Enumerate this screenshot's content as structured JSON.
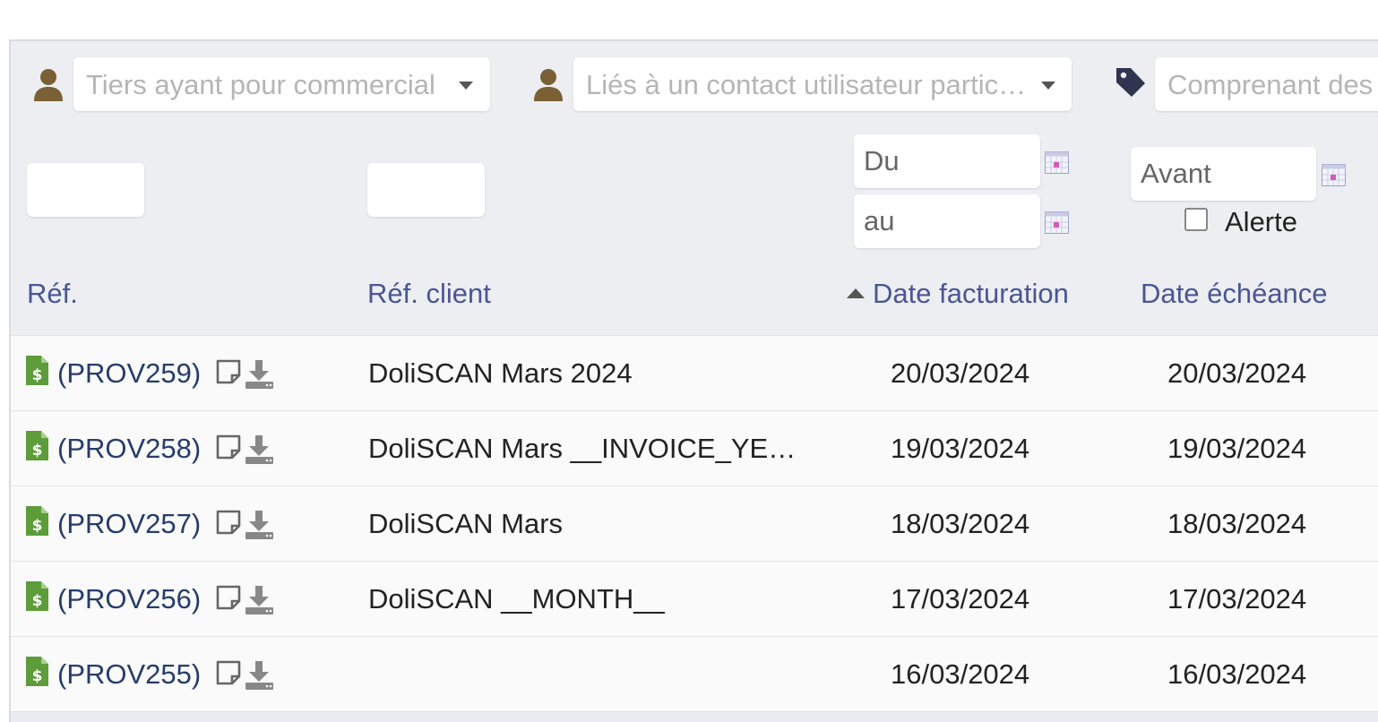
{
  "filters": {
    "sales_rep_placeholder": "Tiers ayant pour commercial",
    "contact_placeholder": "Liés à un contact utilisateur particulier",
    "tag_placeholder": "Comprenant des tags",
    "ref_value": "",
    "ref_client_value": "",
    "date_from_placeholder": "Du",
    "date_to_placeholder": "au",
    "due_before_placeholder": "Avant",
    "alert_label": "Alerte"
  },
  "columns": {
    "ref": "Réf.",
    "ref_client": "Réf. client",
    "date_invoice": "Date facturation",
    "date_due": "Date échéance"
  },
  "rows": [
    {
      "ref": "(PROV259)",
      "client": "DoliSCAN Mars 2024",
      "date_invoice": "20/03/2024",
      "date_due": "20/03/2024"
    },
    {
      "ref": "(PROV258)",
      "client": "DoliSCAN Mars __INVOICE_YEAR__",
      "date_invoice": "19/03/2024",
      "date_due": "19/03/2024"
    },
    {
      "ref": "(PROV257)",
      "client": "DoliSCAN Mars",
      "date_invoice": "18/03/2024",
      "date_due": "18/03/2024"
    },
    {
      "ref": "(PROV256)",
      "client": "DoliSCAN __MONTH__",
      "date_invoice": "17/03/2024",
      "date_due": "17/03/2024"
    },
    {
      "ref": "(PROV255)",
      "client": "",
      "date_invoice": "16/03/2024",
      "date_due": "16/03/2024"
    }
  ],
  "icons": {
    "user": "user-icon",
    "tag": "tag-icon",
    "calendar": "calendar-icon",
    "invoice": "invoice-icon",
    "note": "note-icon",
    "download": "download-icon"
  },
  "colors": {
    "link": "#263c6b",
    "header_link": "#4a5597",
    "invoice_icon": "#5d9c3a",
    "panel_bg": "#eceef1"
  }
}
